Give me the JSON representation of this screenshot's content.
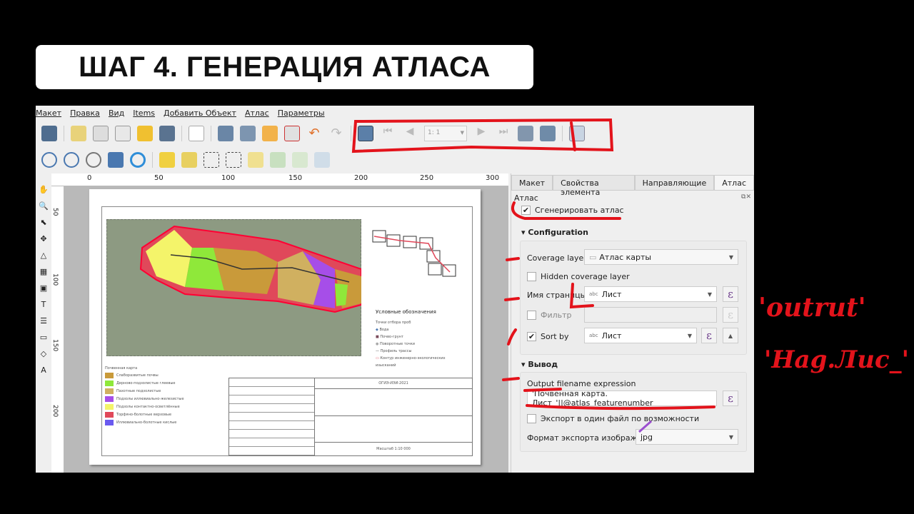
{
  "title": "ШАГ 4. ГЕНЕРАЦИЯ АТЛАСА",
  "menu": [
    "Макет",
    "Правка",
    "Вид",
    "Items",
    "Добавить Объект",
    "Атлас",
    "Параметры"
  ],
  "atlas_toolbar": {
    "page_value": "1: 1"
  },
  "ruler_ticks": [
    "0",
    "50",
    "100",
    "150",
    "200",
    "250",
    "300"
  ],
  "vruler_ticks": [
    "50",
    "100",
    "150",
    "200"
  ],
  "panel": {
    "tabs": [
      "Макет",
      "Свойства элемента",
      "Направляющие",
      "Атлас"
    ],
    "active_tab": "Атлас",
    "header": "Атлас",
    "generate_atlas": {
      "label": "Сгенерировать атлас",
      "checked": true
    },
    "configuration": {
      "title": "Configuration",
      "coverage_layer_label": "Coverage layer",
      "coverage_layer_value": "Атлас карты",
      "hidden_coverage_label": "Hidden coverage layer",
      "page_name_label": "Имя страницы",
      "page_name_value": "Лист",
      "filter_label": "Фильтр",
      "sort_by_label": "Sort by",
      "sort_by_value": "Лист",
      "abc": "abc"
    },
    "output": {
      "title": "Вывод",
      "filename_label": "Output filename expression",
      "filename_value": "'Почвенная карта. Лист_'||@atlas_featurenumber",
      "single_file_label": "Экспорт в один файл по возможности",
      "format_label": "Формат экспорта изображени",
      "format_value": "jpg"
    },
    "epsilon": "ε"
  },
  "map": {
    "legend_title": "Условные обозначения",
    "legend_items": [
      "Точки отбора проб",
      "Вода",
      "Почво-грунт",
      "Поворотные точки",
      "Профиль трассы",
      "Контур инженерно-экологических изысканий"
    ],
    "soil_title": "Почвенная карта",
    "soil_items": [
      {
        "label": "Слаборазвитые почвы",
        "color": "#c99a3a"
      },
      {
        "label": "Дерново-подзолистые глеевые",
        "color": "#8fe83a"
      },
      {
        "label": "Пахотные подзолистые",
        "color": "#d0b060"
      },
      {
        "label": "Подзолы иллювиально-железистые",
        "color": "#a64ee8"
      },
      {
        "label": "Подзолы контактно-осветлённые",
        "color": "#f4f46a"
      },
      {
        "label": "Торфяно-болотные верховые",
        "color": "#e0485a"
      },
      {
        "label": "Иллювиально-болотные кислые",
        "color": "#6a5af0"
      }
    ],
    "stamp_code": "ОГИЭ-ИЭИ-2021",
    "stamp_scale": "Масштаб 1:10 000"
  },
  "annotations": [
    "'outrut'",
    "'Hag.Лис_'"
  ],
  "colors": {
    "annotation": "#e3131b",
    "background": "#000000"
  }
}
